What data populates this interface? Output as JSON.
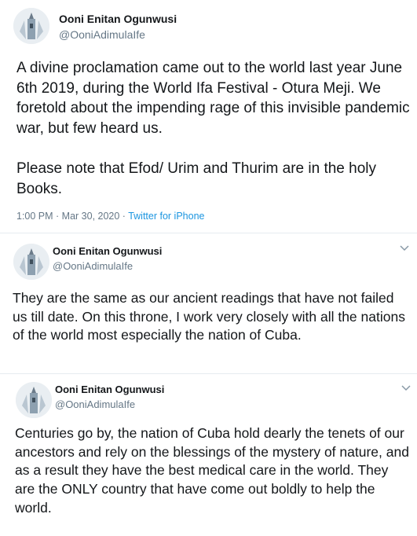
{
  "colors": {
    "link": "#1b95e0",
    "muted": "#657786",
    "text": "#14171a",
    "separator": "#e6ecf0"
  },
  "tweets": [
    {
      "author_name": "Ooni Enitan Ogunwusi",
      "author_handle": "@OoniAdimulaIfe",
      "avatar_icon": "avatar-photo",
      "text": "A divine proclamation came out to the world last year June 6th 2019, during the World Ifa Festival - Otura Meji. We foretold about the impending rage of this invisible pandemic war, but few heard us.\n\nPlease note that Efod/ Urim and Thurim are in the holy Books.",
      "timestamp": "1:00 PM · Mar 30, 2020 · ",
      "source": "Twitter for iPhone"
    },
    {
      "author_name": "Ooni Enitan Ogunwusi",
      "author_handle": "@OoniAdimulaIfe",
      "avatar_icon": "avatar-photo",
      "menu_icon": "chevron-down-icon",
      "text": "They are the same as our ancient readings that have not failed us till date. On this throne, I work very closely with all the nations of the world most especially the nation of Cuba."
    },
    {
      "author_name": "Ooni Enitan Ogunwusi",
      "author_handle": "@OoniAdimulaIfe",
      "avatar_icon": "avatar-photo",
      "menu_icon": "chevron-down-icon",
      "text": "Centuries go by, the nation of Cuba hold dearly the tenets of our ancestors and rely on the blessings of the mystery of nature, and as a result they have the best medical care in the world. They are the ONLY country that have come out boldly to help the world."
    }
  ]
}
